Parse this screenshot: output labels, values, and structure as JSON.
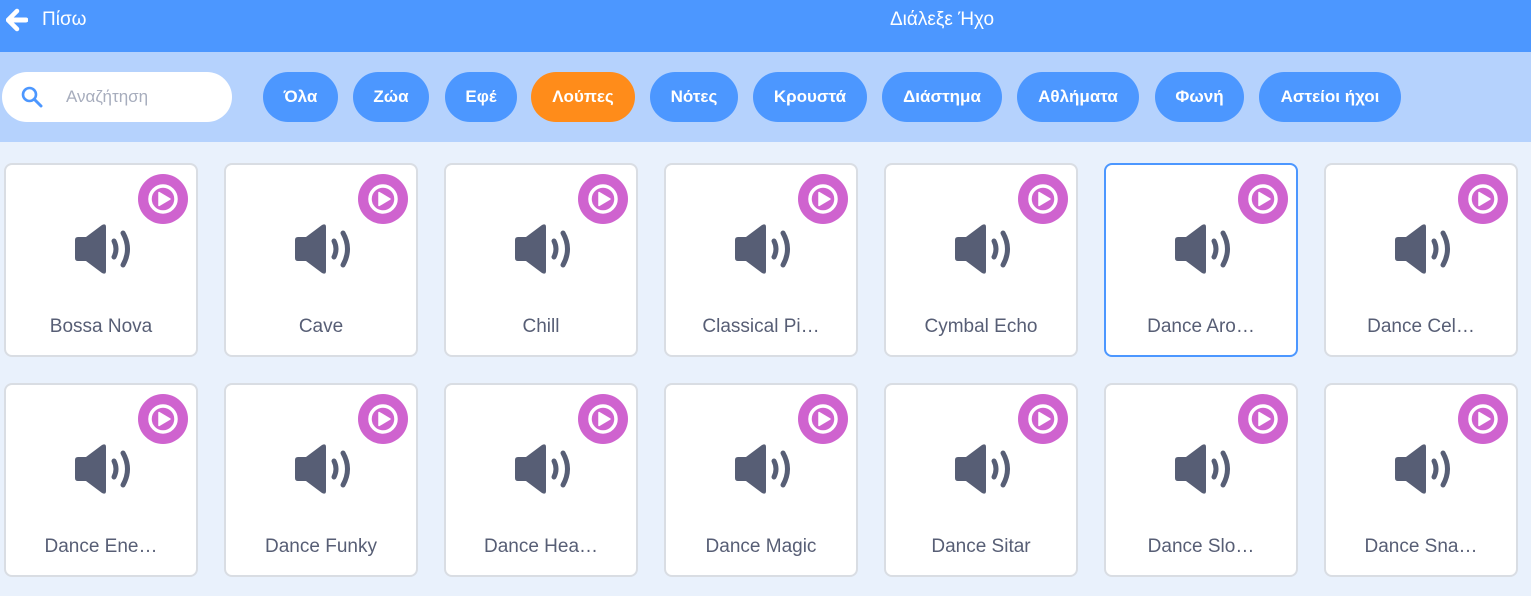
{
  "header": {
    "back_label": "Πίσω",
    "title": "Διάλεξε Ήχο"
  },
  "search": {
    "placeholder": "Αναζήτηση",
    "value": ""
  },
  "tags": [
    {
      "label": "Όλα",
      "active": false
    },
    {
      "label": "Ζώα",
      "active": false
    },
    {
      "label": "Εφέ",
      "active": false
    },
    {
      "label": "Λούπες",
      "active": true
    },
    {
      "label": "Νότες",
      "active": false
    },
    {
      "label": "Κρουστά",
      "active": false
    },
    {
      "label": "Διάστημα",
      "active": false
    },
    {
      "label": "Αθλήματα",
      "active": false
    },
    {
      "label": "Φωνή",
      "active": false
    },
    {
      "label": "Αστείοι ήχοι",
      "active": false
    }
  ],
  "sounds": [
    {
      "label": "Bossa Nova",
      "selected": false
    },
    {
      "label": "Cave",
      "selected": false
    },
    {
      "label": "Chill",
      "selected": false
    },
    {
      "label": "Classical Pi…",
      "selected": false
    },
    {
      "label": "Cymbal Echo",
      "selected": false
    },
    {
      "label": "Dance Aro…",
      "selected": true
    },
    {
      "label": "Dance Cel…",
      "selected": false
    },
    {
      "label": "Dance Ene…",
      "selected": false
    },
    {
      "label": "Dance Funky",
      "selected": false
    },
    {
      "label": "Dance Hea…",
      "selected": false
    },
    {
      "label": "Dance Magic",
      "selected": false
    },
    {
      "label": "Dance Sitar",
      "selected": false
    },
    {
      "label": "Dance Slo…",
      "selected": false
    },
    {
      "label": "Dance Sna…",
      "selected": false
    }
  ],
  "icons": {
    "back": "back-arrow-icon",
    "search": "search-icon",
    "play": "play-icon",
    "sound": "speaker-icon"
  },
  "colors": {
    "header": "#4c97ff",
    "filter_bar": "#b5d2fd",
    "tag": "#4c97ff",
    "tag_active": "#ff8c1a",
    "play_button": "#cf63cf",
    "speaker": "#575e75",
    "selected_border": "#4c97ff"
  }
}
